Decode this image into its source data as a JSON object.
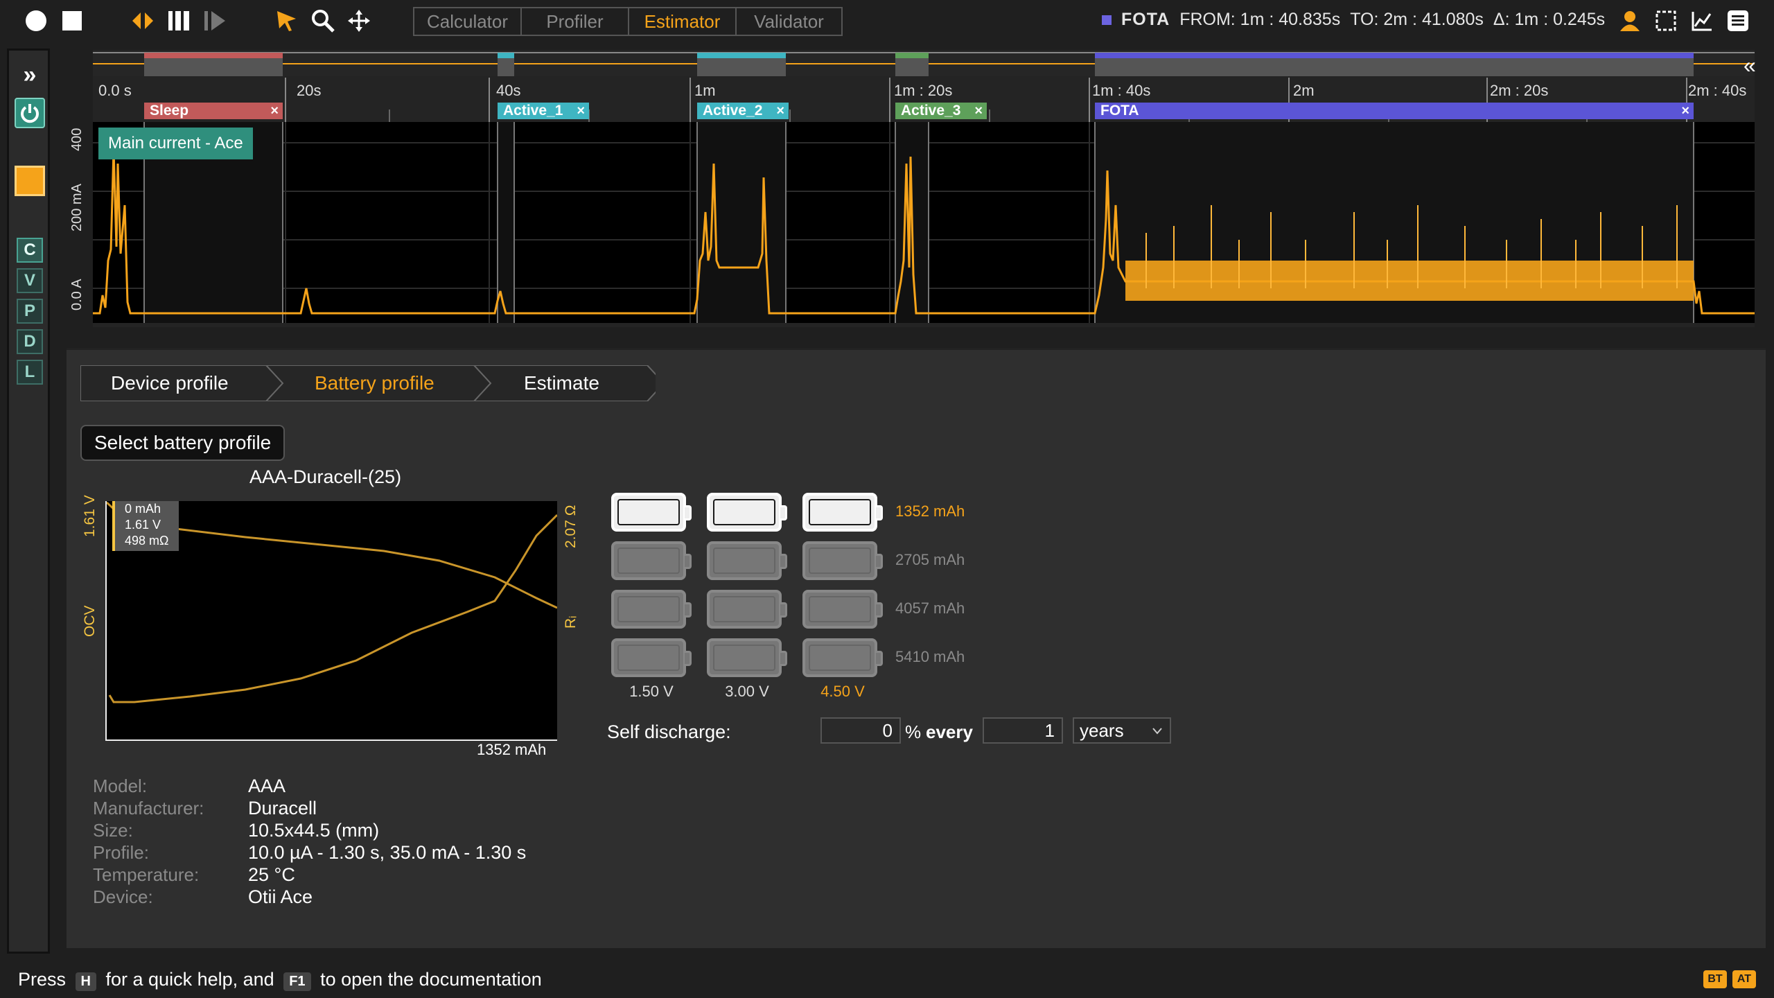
{
  "toolbar": {
    "tabs": [
      {
        "label": "Calculator",
        "active": false
      },
      {
        "label": "Profiler",
        "active": false
      },
      {
        "label": "Estimator",
        "active": true
      },
      {
        "label": "Validator",
        "active": false
      }
    ],
    "range": {
      "tag": "FOTA",
      "from": "FROM: 1m : 40.835s",
      "to": "TO: 2m : 41.080s",
      "delta": "Δ: 1m : 0.245s"
    }
  },
  "sidebar": {
    "expand": "»",
    "letters": [
      "C",
      "V",
      "P",
      "D",
      "L"
    ]
  },
  "timeline": {
    "collapse": "«",
    "ticks": [
      "0.0 s",
      "20s",
      "40s",
      "1m",
      "1m : 20s",
      "1m : 40s",
      "2m",
      "2m : 20s",
      "2m : 40s"
    ],
    "tags": [
      {
        "label": "Sleep",
        "color": "#c25a5a"
      },
      {
        "label": "Active_1",
        "color": "#3fb5c2"
      },
      {
        "label": "Active_2",
        "color": "#3fb5c2"
      },
      {
        "label": "Active_3",
        "color": "#5ea05a"
      },
      {
        "label": "FOTA",
        "color": "#5b55d6"
      }
    ],
    "tag_close": "×",
    "y_ticks": [
      "400",
      "200 mA",
      "0.0 A"
    ],
    "trace_label": "Main current - Ace"
  },
  "estimator": {
    "steps": [
      "Device profile",
      "Battery profile",
      "Estimate"
    ],
    "active_step": "Battery profile",
    "select_button": "Select battery profile",
    "battery_name": "AAA-Duracell-(25)",
    "chart": {
      "tip": [
        "0 mAh",
        "1.61 V",
        "498 mΩ"
      ],
      "left_axis_top": "1.61 V",
      "left_axis_name": "OCV",
      "right_axis_top": "2.07 Ω",
      "right_axis_name": "Rᵢ",
      "x_label": "1352 mAh"
    },
    "capacities": [
      "1352 mAh",
      "2705 mAh",
      "4057 mAh",
      "5410 mAh"
    ],
    "voltages": [
      "1.50 V",
      "3.00 V",
      "4.50 V"
    ],
    "selected_row": 0,
    "selected_col": 2,
    "self_discharge": {
      "label": "Self discharge:",
      "percent_value": "0",
      "percent_unit": "%",
      "every": "every",
      "period_value": "1",
      "period_unit": "years"
    },
    "info": [
      {
        "k": "Model:",
        "v": "AAA"
      },
      {
        "k": "Manufacturer:",
        "v": "Duracell"
      },
      {
        "k": "Size:",
        "v": "10.5x44.5 (mm)"
      },
      {
        "k": "Profile:",
        "v": "10.0 µA - 1.30 s, 35.0 mA - 1.30 s"
      },
      {
        "k": "Temperature:",
        "v": "25 °C"
      },
      {
        "k": "Device:",
        "v": "Otii Ace"
      }
    ]
  },
  "statusbar": {
    "press": "Press",
    "key_h": "H",
    "mid": "for a quick help, and",
    "key_f1": "F1",
    "end": "to open the documentation",
    "badges": [
      "BT",
      "AT"
    ]
  }
}
